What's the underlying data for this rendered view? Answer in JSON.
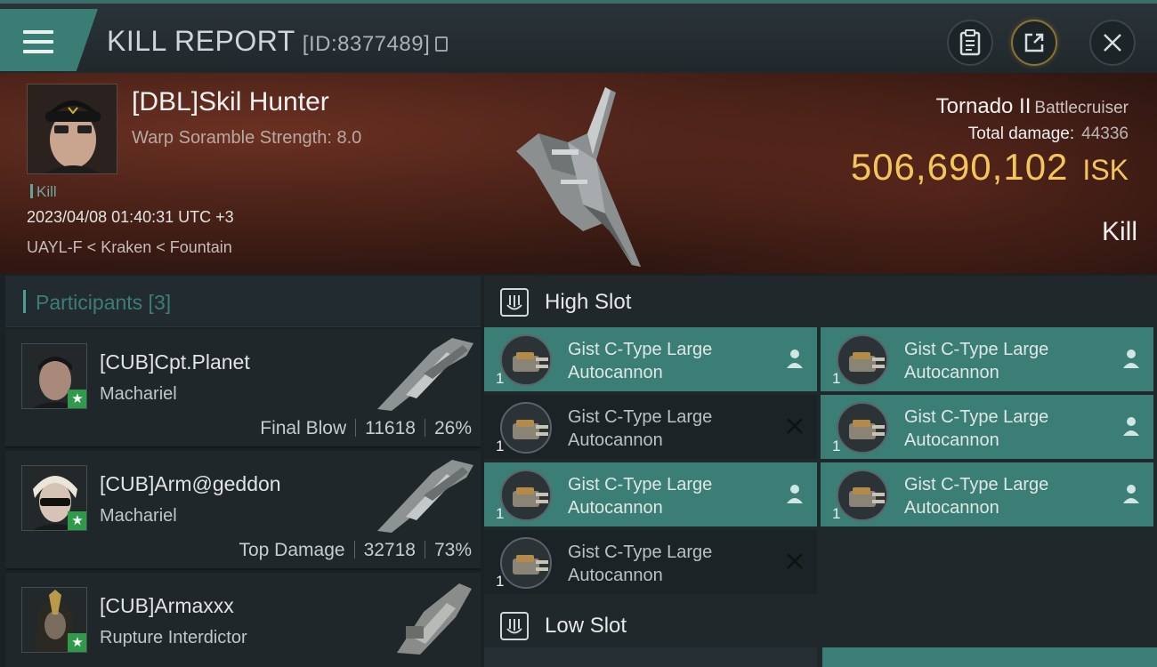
{
  "header": {
    "title": "KILL REPORT",
    "report_id": "[ID:8377489]"
  },
  "victim": {
    "name": "[DBL]Skil Hunter",
    "scramble": "Warp Soramble Strength: 8.0",
    "tag": "Kill",
    "timestamp": "2023/04/08 01:40:31 UTC +3",
    "location": "UAYL-F < Kraken < Fountain",
    "ship_name": "Tornado II",
    "ship_class": "Battlecruiser",
    "damage_label": "Total damage:",
    "damage_value": "44336",
    "isk_value": "506,690,102",
    "isk_unit": "ISK",
    "result": "Kill"
  },
  "participants": {
    "title": "Participants [3]",
    "rows": [
      {
        "name": "[CUB]Cpt.Planet",
        "ship": "Machariel",
        "stat_label": "Final Blow",
        "damage": "11618",
        "percent": "26%"
      },
      {
        "name": "[CUB]Arm@geddon",
        "ship": "Machariel",
        "stat_label": "Top Damage",
        "damage": "32718",
        "percent": "73%"
      },
      {
        "name": "[CUB]Armaxxx",
        "ship": "Rupture Interdictor"
      }
    ]
  },
  "slots": {
    "high": {
      "title": "High Slot",
      "modules": [
        {
          "qty": "1",
          "line1": "Gist C-Type Large",
          "line2": "Autocannon",
          "status": "fitted"
        },
        {
          "qty": "1",
          "line1": "Gist C-Type Large",
          "line2": "Autocannon",
          "status": "fitted"
        },
        {
          "qty": "1",
          "line1": "Gist C-Type Large",
          "line2": "Autocannon",
          "status": "destroyed"
        },
        {
          "qty": "1",
          "line1": "Gist C-Type Large",
          "line2": "Autocannon",
          "status": "fitted"
        },
        {
          "qty": "1",
          "line1": "Gist C-Type Large",
          "line2": "Autocannon",
          "status": "fitted"
        },
        {
          "qty": "1",
          "line1": "Gist C-Type Large",
          "line2": "Autocannon",
          "status": "fitted"
        },
        {
          "qty": "1",
          "line1": "Gist C-Type Large",
          "line2": "Autocannon",
          "status": "destroyed"
        }
      ]
    },
    "low": {
      "title": "Low Slot"
    }
  },
  "colors": {
    "accent": "#3b7e75",
    "isk": "#f4c55b",
    "star": "#2e9a4a"
  },
  "icons": [
    "menu-icon",
    "copy-icon",
    "clipboard-icon",
    "share-icon",
    "close-icon",
    "slot-icon",
    "pilot-icon",
    "destroyed-x-icon",
    "star-icon"
  ]
}
